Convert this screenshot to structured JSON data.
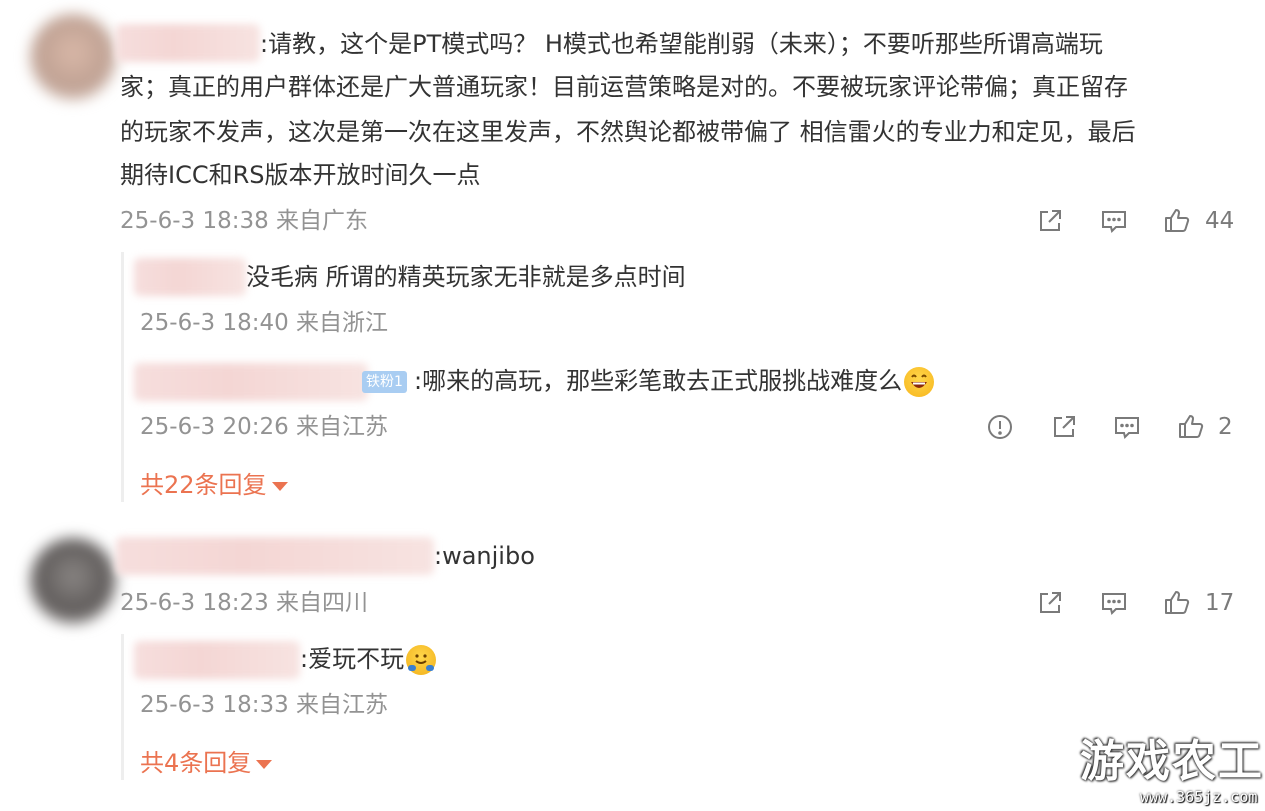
{
  "comments": [
    {
      "text_lines": [
        "请教，这个是PT模式吗？  H模式也希望能削弱（未来）；不要听那些所谓高端玩",
        "家；真正的用户群体还是广大普通玩家！目前运营策略是对的。不要被玩家评论带偏；真正留存",
        "的玩家不发声，这次是第一次在这里发声，不然舆论都被带偏了 相信雷火的专业力和定见，最后",
        "期待ICC和RS版本开放时间久一点"
      ],
      "text_prefix": ":",
      "meta": "25-6-3 18:38 来自广东",
      "likes": "44",
      "replies": [
        {
          "text": "没毛病 所谓的精英玩家无非就是多点时间",
          "meta": "25-6-3 18:40 来自浙江"
        },
        {
          "badge": "铁粉1",
          "text": ":哪来的高玩，那些彩笔敢去正式服挑战难度么",
          "meta": "25-6-3 20:26 来自江苏",
          "likes": "2"
        }
      ],
      "more_replies": "共22条回复"
    },
    {
      "text": ":wanjibo",
      "meta": "25-6-3 18:23 来自四川",
      "likes": "17",
      "replies": [
        {
          "text": ":爱玩不玩",
          "meta": "25-6-3 18:33 来自江苏"
        }
      ],
      "more_replies": "共4条回复"
    }
  ],
  "watermark": {
    "title": "游戏农工",
    "url": "www.365jz.com"
  },
  "icons": [
    "share-icon",
    "comment-icon",
    "like-icon",
    "report-icon",
    "grinning-emoji",
    "hug-emoji"
  ],
  "colors": {
    "accent": "#eb7350",
    "meta": "#939393",
    "badge": "#a9cdf2"
  }
}
